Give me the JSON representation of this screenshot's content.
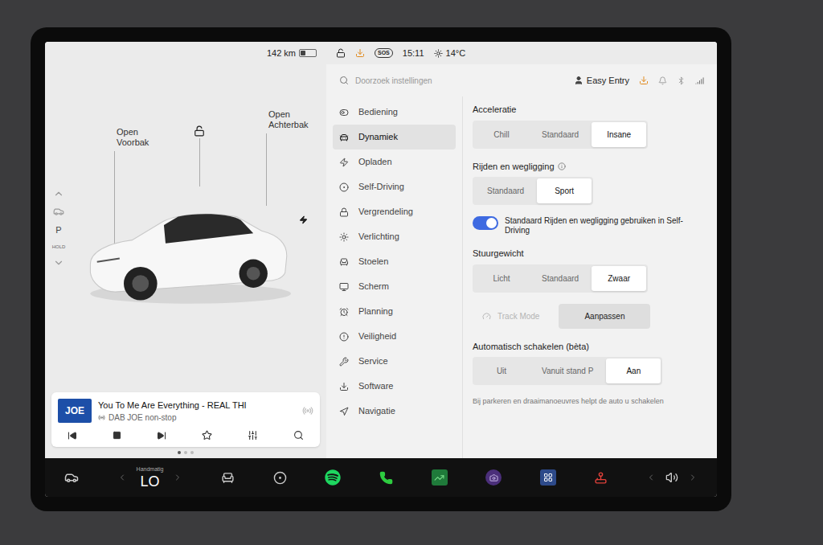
{
  "status_bar": {
    "range": "142 km",
    "battery_level": 0.35,
    "sos": "SOS",
    "time": "15:11",
    "temperature": "14°C"
  },
  "gear": {
    "label": "P",
    "sub": "HOLD"
  },
  "car_view": {
    "front": {
      "top": "Open",
      "bottom": "Voorbak"
    },
    "rear": {
      "top": "Open",
      "bottom": "Achterbak"
    },
    "locked": false,
    "charging": true
  },
  "media": {
    "logo": "JOE",
    "title": "You To Me Are Everything - REAL THI",
    "subtitle": "DAB JOE non-stop",
    "favorite": false,
    "page": 0,
    "pages": 3
  },
  "search": {
    "placeholder": "Doorzoek instellingen"
  },
  "profile": {
    "name": "Easy Entry"
  },
  "sidebar": {
    "items": [
      {
        "label": "Bediening",
        "selected": false
      },
      {
        "label": "Dynamiek",
        "selected": true
      },
      {
        "label": "Opladen",
        "selected": false
      },
      {
        "label": "Self-Driving",
        "selected": false
      },
      {
        "label": "Vergrendeling",
        "selected": false
      },
      {
        "label": "Verlichting",
        "selected": false
      },
      {
        "label": "Stoelen",
        "selected": false
      },
      {
        "label": "Scherm",
        "selected": false
      },
      {
        "label": "Planning",
        "selected": false
      },
      {
        "label": "Veiligheid",
        "selected": false
      },
      {
        "label": "Service",
        "selected": false
      },
      {
        "label": "Software",
        "selected": false
      },
      {
        "label": "Navigatie",
        "selected": false
      }
    ]
  },
  "settings": [
    {
      "kind": "segmented",
      "title": "Acceleratie",
      "info": false,
      "options": [
        {
          "label": "Chill",
          "selected": false
        },
        {
          "label": "Standaard",
          "selected": false
        },
        {
          "label": "Insane",
          "selected": true
        }
      ]
    },
    {
      "kind": "segmented",
      "title": "Rijden en wegligging",
      "info": true,
      "options": [
        {
          "label": "Standaard",
          "selected": false
        },
        {
          "label": "Sport",
          "selected": true
        }
      ]
    },
    {
      "kind": "toggle",
      "label": "Standaard Rijden en wegligging gebruiken in Self-Driving",
      "on": true
    },
    {
      "kind": "segmented",
      "title": "Stuurgewicht",
      "info": false,
      "options": [
        {
          "label": "Licht",
          "selected": false
        },
        {
          "label": "Standaard",
          "selected": false
        },
        {
          "label": "Zwaar",
          "selected": true
        }
      ]
    },
    {
      "kind": "action",
      "label": "Track Mode",
      "disabled": true,
      "button": "Aanpassen"
    },
    {
      "kind": "segmented",
      "title": "Automatisch schakelen (bèta)",
      "info": false,
      "options": [
        {
          "label": "Uit",
          "selected": false
        },
        {
          "label": "Vanuit stand P",
          "selected": false
        },
        {
          "label": "Aan",
          "selected": true
        }
      ]
    },
    {
      "kind": "note",
      "text": "Bij parkeren en draaimanoeuvres helpt de auto u schakelen"
    }
  ],
  "bottom_bar": {
    "climate_mode": "Handmatig",
    "climate_temp": "LO"
  }
}
